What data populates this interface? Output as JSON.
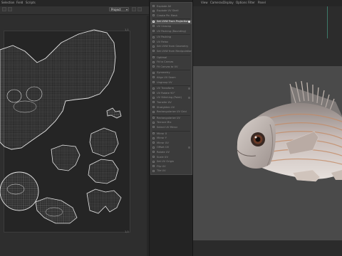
{
  "uv_editor": {
    "menu": [
      "Selection",
      "Field",
      "Scripts"
    ],
    "mode_select": "Project",
    "corner_top_right": "1,1",
    "corner_bottom_right": "1,0"
  },
  "uv_menu": {
    "items": [
      {
        "label": "Explode All",
        "has_shortcut": false,
        "selected": false
      },
      {
        "label": "Explode UV Shell",
        "has_shortcut": false,
        "selected": false
      },
      {
        "label": "Create Pin Mesh",
        "has_shortcut": false,
        "selected": false
      },
      {
        "label": "Set UVW From Projection",
        "has_shortcut": true,
        "selected": true
      },
      {
        "label": "UV Unwrap",
        "has_shortcut": false,
        "selected": false
      },
      {
        "label": "UV Packing (Bounding)",
        "has_shortcut": false,
        "selected": false
      },
      {
        "label": "UV Packing",
        "has_shortcut": false,
        "selected": false
      },
      {
        "label": "UV Relax",
        "has_shortcut": false,
        "selected": false
      },
      {
        "label": "Set UVW from Geometry",
        "has_shortcut": false,
        "selected": false
      },
      {
        "label": "Set UVW from Manipulation",
        "has_shortcut": false,
        "selected": false
      },
      {
        "label": "Optimal",
        "has_shortcut": false,
        "selected": false
      },
      {
        "label": "Fit to Canvas",
        "has_shortcut": false,
        "selected": false
      },
      {
        "label": "Fit Canvas to UV",
        "has_shortcut": false,
        "selected": false
      },
      {
        "label": "Symmetry",
        "has_shortcut": false,
        "selected": false
      },
      {
        "label": "Align UV Seam",
        "has_shortcut": false,
        "selected": false
      },
      {
        "label": "Ungroup UV",
        "has_shortcut": false,
        "selected": false
      },
      {
        "label": "UV Transform",
        "has_shortcut": true,
        "selected": false
      },
      {
        "label": "UV Rotate 90°",
        "has_shortcut": false,
        "selected": false
      },
      {
        "label": "UV Stitching (Point)",
        "has_shortcut": true,
        "selected": false
      },
      {
        "label": "Transfer UV",
        "has_shortcut": false,
        "selected": false
      },
      {
        "label": "Straighten UV",
        "has_shortcut": false,
        "selected": false
      },
      {
        "label": "Rectangularize UV Grid",
        "has_shortcut": false,
        "selected": false
      },
      {
        "label": "Rectangularize UV",
        "has_shortcut": false,
        "selected": false
      },
      {
        "label": "Terrace Mix",
        "has_shortcut": false,
        "selected": false
      },
      {
        "label": "Select UV Mirror",
        "has_shortcut": false,
        "selected": false
      },
      {
        "label": "Mirror X",
        "has_shortcut": false,
        "selected": false
      },
      {
        "label": "Mirror Y",
        "has_shortcut": false,
        "selected": false
      },
      {
        "label": "Mirror UV",
        "has_shortcut": false,
        "selected": false
      },
      {
        "label": "Offset UV",
        "has_shortcut": true,
        "selected": false
      },
      {
        "label": "Rotate UV",
        "has_shortcut": false,
        "selected": false
      },
      {
        "label": "Scale UV",
        "has_shortcut": false,
        "selected": false
      },
      {
        "label": "Set UV Origin",
        "has_shortcut": false,
        "selected": false
      },
      {
        "label": "Flip UV",
        "has_shortcut": false,
        "selected": false
      },
      {
        "label": "Tile UV",
        "has_shortcut": false,
        "selected": false
      }
    ]
  },
  "viewport": {
    "menu": [
      "View",
      "Cameras",
      "Display",
      "Options",
      "Filter",
      "Panel"
    ]
  },
  "colors": {
    "wire": "#dcdcdc",
    "fish_body": "#b7a8a4",
    "fish_stripe": "#c9906a",
    "viewport_bg": "#4a4a4a"
  }
}
